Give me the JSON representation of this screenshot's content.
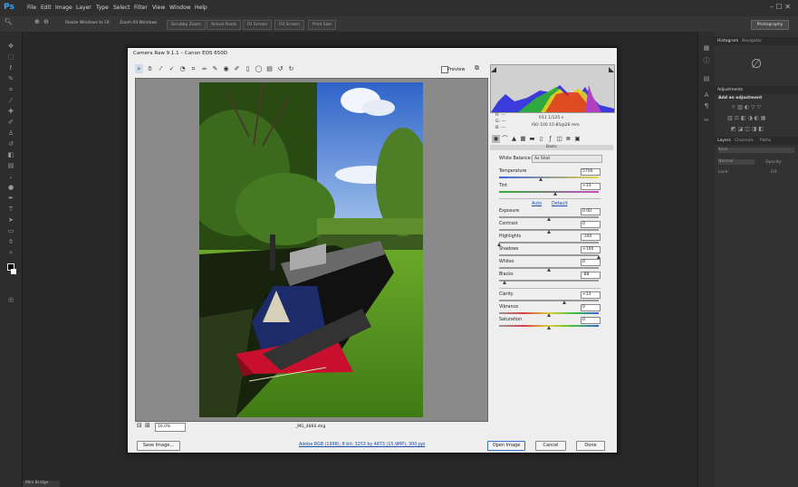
{
  "app": {
    "logo": "Ps",
    "menus": [
      "File",
      "Edit",
      "Image",
      "Layer",
      "Type",
      "Select",
      "Filter",
      "View",
      "Window",
      "Help"
    ],
    "window_controls": "–  ☐  ✕",
    "workspace": "Photography"
  },
  "options_bar": {
    "buttons": [
      "Resize Windows to Fit",
      "Zoom All Windows",
      "Scrubby Zoom",
      "Actual Pixels",
      "Fit Screen",
      "Fill Screen",
      "Print Size"
    ]
  },
  "right_panels": {
    "histogram_tabs": [
      "Histogram",
      "Navigator"
    ],
    "adjustments_title": "Adjustments",
    "add_adjustment": "Add an adjustment",
    "layers_tabs": [
      "Layers",
      "Channels",
      "Paths"
    ],
    "kind": "Kind",
    "blend_mode": "Normal",
    "opacity": "Opacity:",
    "lock": "Lock:",
    "fill": "Fill:"
  },
  "status": {
    "tab": "Mini Bridge"
  },
  "dialog": {
    "title": "Camera Raw 9.1.1  –  Canon EOS 650D",
    "preview_label": "Preview",
    "zoom_value": "16.0%",
    "filename": "_MG_4860.dng",
    "camera": {
      "r": "R:   ---",
      "g": "G:   ---",
      "b": "B:   ---",
      "aperture_shutter": "f/11   1/125 s",
      "iso_lens": "ISO 100   15-85@26 mm"
    },
    "panel_title": "Basic",
    "white_balance_label": "White Balance:",
    "white_balance_value": "As Shot",
    "sliders": {
      "temperature": {
        "label": "Temperature",
        "value": "5700",
        "pos": 0.42
      },
      "tint": {
        "label": "Tint",
        "value": "+13",
        "pos": 0.57
      },
      "exposure": {
        "label": "Exposure",
        "value": "0.00",
        "pos": 0.5
      },
      "contrast": {
        "label": "Contrast",
        "value": "0",
        "pos": 0.5
      },
      "highlights": {
        "label": "Highlights",
        "value": "-100",
        "pos": 0.0
      },
      "shadows": {
        "label": "Shadows",
        "value": "+100",
        "pos": 1.0
      },
      "whites": {
        "label": "Whites",
        "value": "0",
        "pos": 0.5
      },
      "blacks": {
        "label": "Blacks",
        "value": "-88",
        "pos": 0.06
      },
      "clarity": {
        "label": "Clarity",
        "value": "+33",
        "pos": 0.66
      },
      "vibrance": {
        "label": "Vibrance",
        "value": "0",
        "pos": 0.5
      },
      "saturation": {
        "label": "Saturation",
        "value": "0",
        "pos": 0.5
      }
    },
    "auto": "Auto",
    "default": "Default",
    "save_image": "Save Image...",
    "workflow": "Adobe RGB (1998); 8 bit; 3253 by 4873 (15.9MP); 300 ppi",
    "open_image": "Open Image",
    "cancel": "Cancel",
    "done": "Done"
  },
  "colors": {
    "ps_blue": "#31a8ff",
    "link_blue": "#1b4fa8",
    "boat_red": "#c8102e"
  }
}
